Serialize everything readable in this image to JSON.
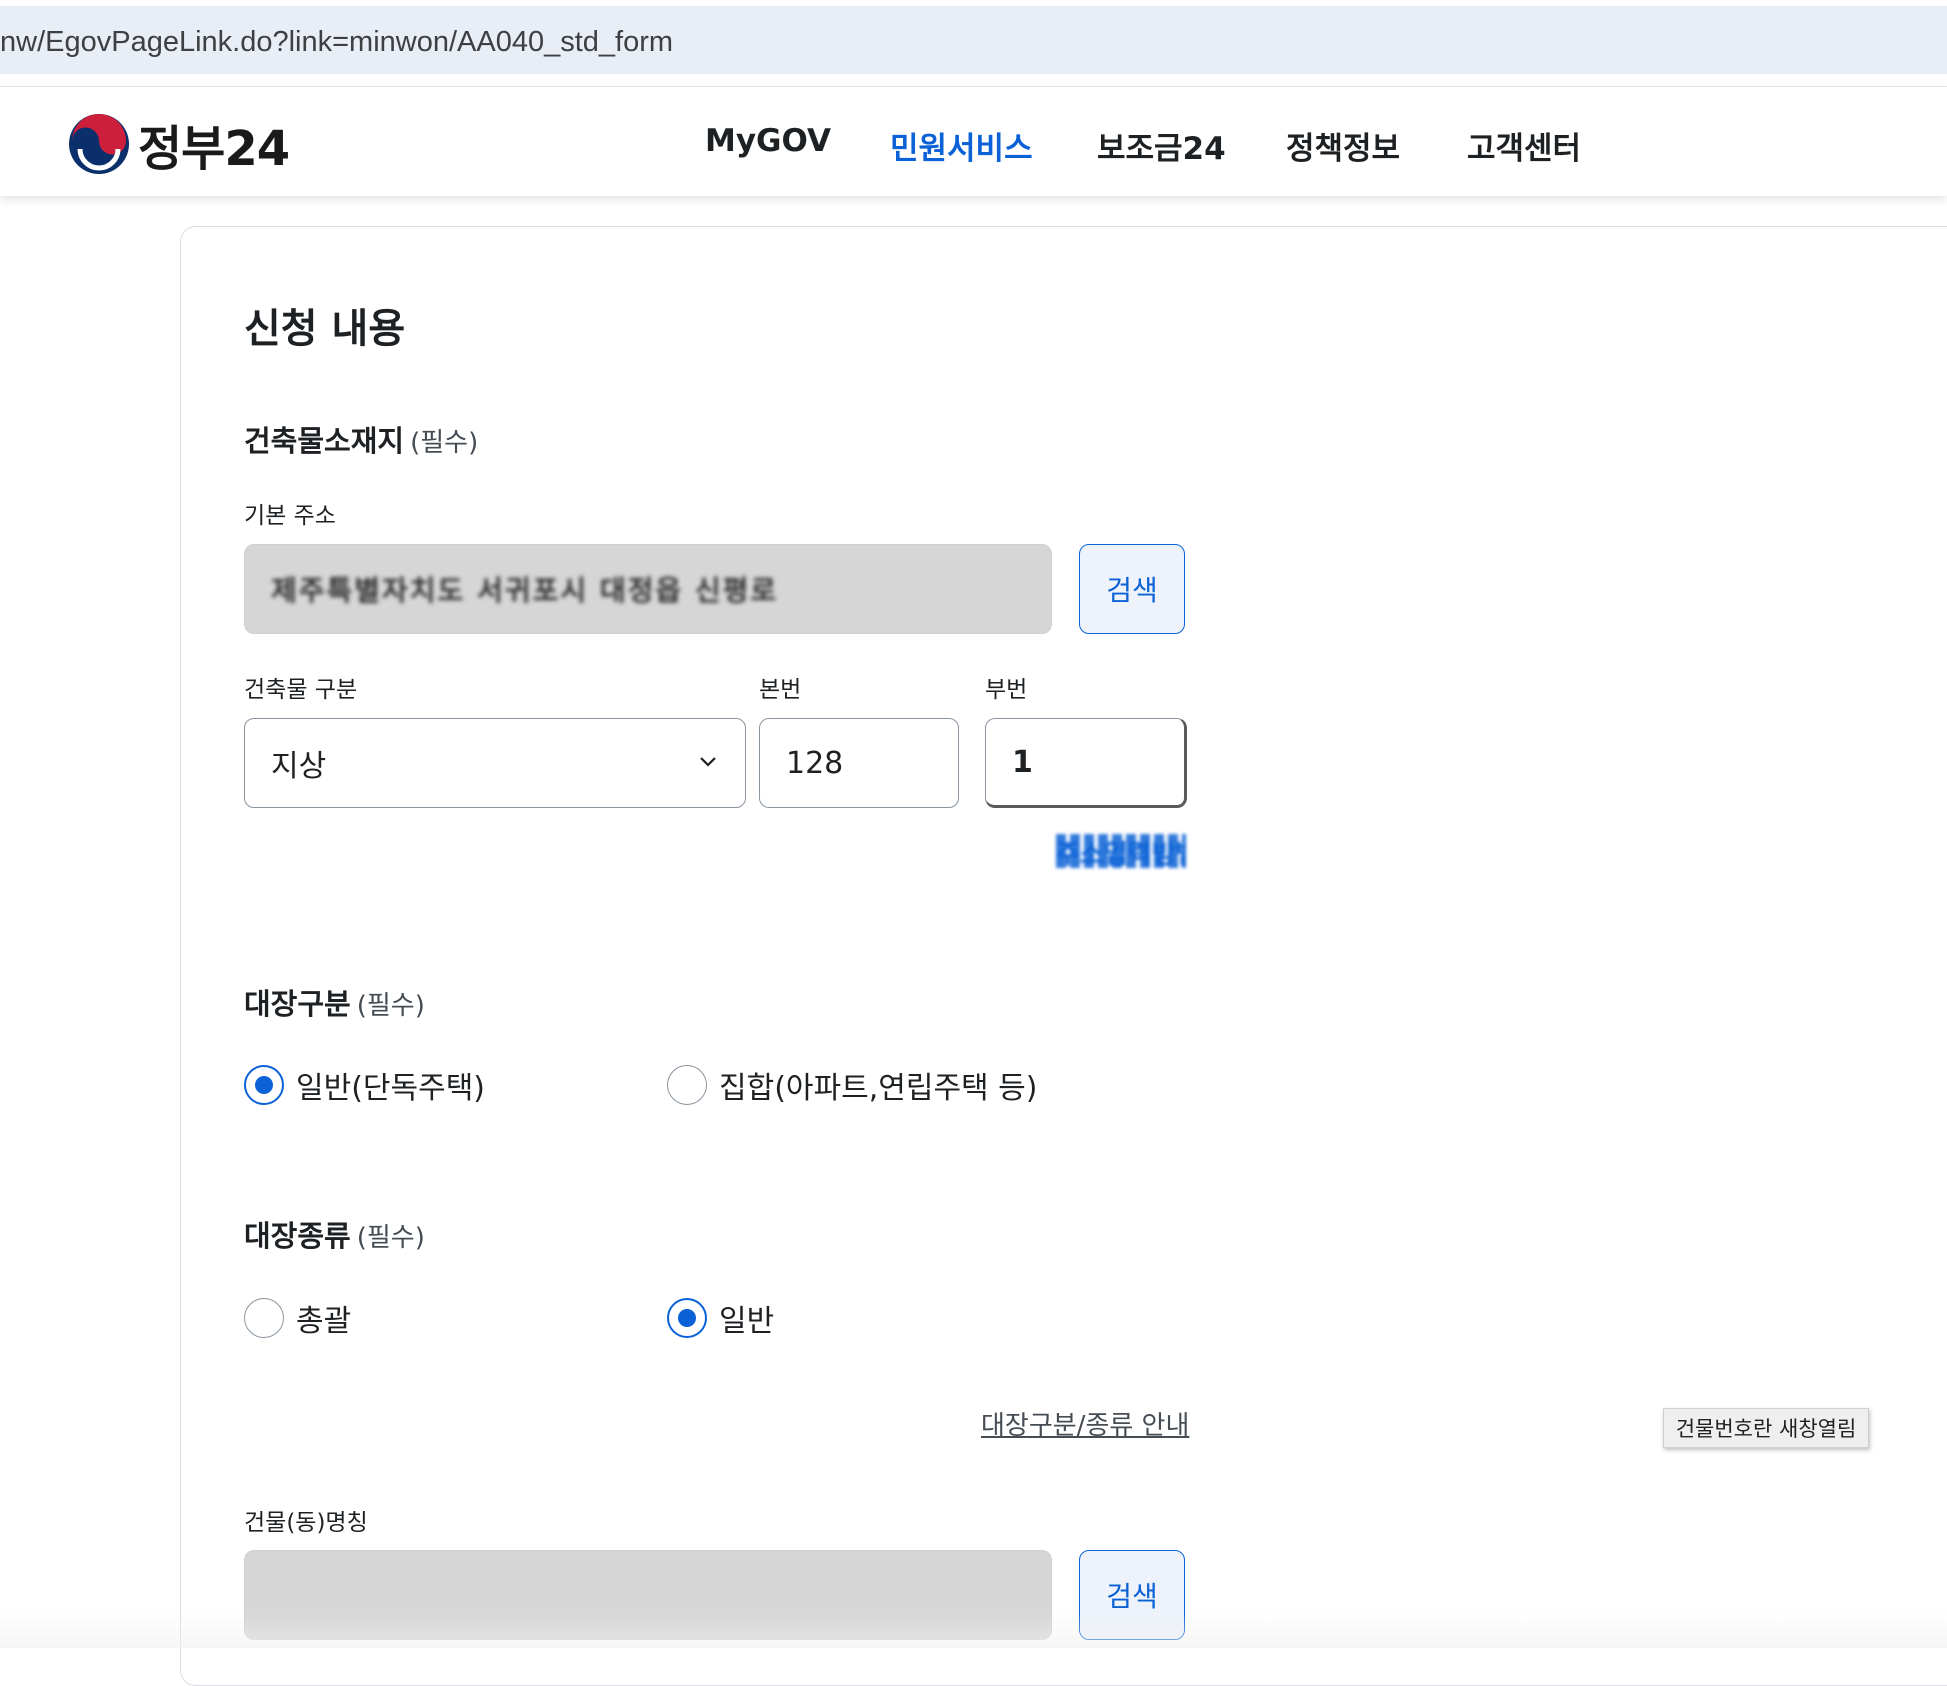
{
  "browser": {
    "url": "nw/EgovPageLink.do?link=minwon/AA040_std_form"
  },
  "header": {
    "logo_text": "정부24",
    "logo_icon": "taegeuk-icon",
    "nav": [
      {
        "label": "MyGOV",
        "active": false
      },
      {
        "label": "민원서비스",
        "active": true
      },
      {
        "label": "보조금24",
        "active": false
      },
      {
        "label": "정책정보",
        "active": false
      },
      {
        "label": "고객센터",
        "active": false
      }
    ]
  },
  "colors": {
    "accent": "#0b62d6",
    "disabled_input": "#d6d6d6"
  },
  "form": {
    "title": "신청 내용",
    "location": {
      "label": "건축물소재지",
      "required": "(필수)",
      "base_address_label": "기본 주소",
      "base_address_value": "제주특별자치도 서귀포시 대정읍 신평로",
      "search_button": "검색",
      "building_type_label": "건축물 구분",
      "building_type_value": "지상",
      "main_number_label": "본번",
      "main_number_value": "128",
      "sub_number_label": "부번",
      "sub_number_value": "1",
      "blurred_link": "주소입력방법"
    },
    "ledger_category": {
      "label": "대장구분",
      "required": "(필수)",
      "options": [
        {
          "label": "일반(단독주택)",
          "checked": true
        },
        {
          "label": "집합(아파트,연립주택 등)",
          "checked": false
        }
      ]
    },
    "ledger_type": {
      "label": "대장종류",
      "required": "(필수)",
      "options": [
        {
          "label": "총괄",
          "checked": false
        },
        {
          "label": "일반",
          "checked": true
        }
      ],
      "guide_link": "대장구분/종류 안내"
    },
    "building_name": {
      "label": "건물(동)명칭",
      "value": "",
      "search_button": "검색"
    }
  },
  "tooltip": "건물번호란 새창열림"
}
